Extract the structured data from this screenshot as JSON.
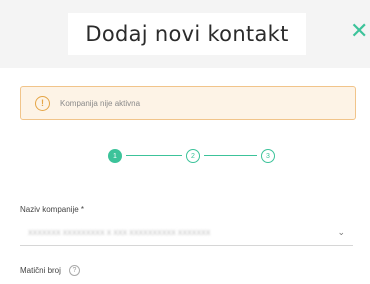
{
  "modal": {
    "title": "Dodaj novi kontakt",
    "close_icon": "close-icon",
    "accent_color": "#3cc39a"
  },
  "alert": {
    "icon": "info-circle-icon",
    "text": "Kompanija nije aktivna",
    "background": "#fdf3e6",
    "border_color": "#f1c48a"
  },
  "stepper": {
    "steps": [
      "1",
      "2",
      "3"
    ],
    "current_step": 1
  },
  "form": {
    "company_label": "Naziv kompanije *",
    "company_value": "XXXXXXX XXXXXXXXX X XXX XXXXXXXXXX XXXXXXX",
    "mb_label": "Matični broj",
    "mb_help_icon": "question-circle-icon"
  }
}
